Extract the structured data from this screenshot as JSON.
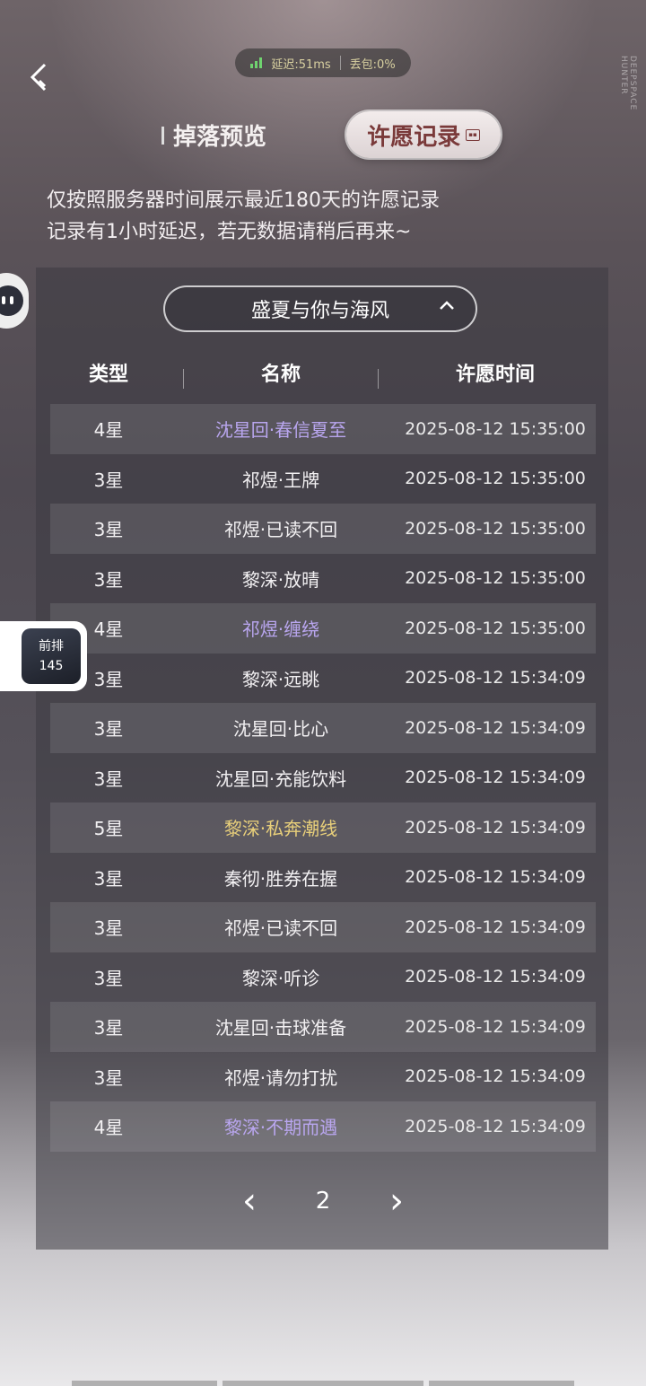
{
  "status": {
    "latency": "延迟:51ms",
    "loss": "丢包:0%"
  },
  "brand": "DEEPSPACE HUNTER",
  "tabs": {
    "drop_preview": "掉落预览",
    "wish_record": "许愿记录"
  },
  "notice": {
    "line1": "仅按照服务器时间展示最近180天的许愿记录",
    "line2": "记录有1小时延迟，若无数据请稍后再来~"
  },
  "selector": {
    "value": "盛夏与你与海风"
  },
  "table": {
    "headers": {
      "type": "类型",
      "name": "名称",
      "time": "许愿时间"
    },
    "rows": [
      {
        "type": "4星",
        "name": "沈星回·春信夏至",
        "time": "2025-08-12 15:35:00"
      },
      {
        "type": "3星",
        "name": "祁煜·王牌",
        "time": "2025-08-12 15:35:00"
      },
      {
        "type": "3星",
        "name": "祁煜·已读不回",
        "time": "2025-08-12 15:35:00"
      },
      {
        "type": "3星",
        "name": "黎深·放晴",
        "time": "2025-08-12 15:35:00"
      },
      {
        "type": "4星",
        "name": "祁煜·缠绕",
        "time": "2025-08-12 15:35:00"
      },
      {
        "type": "3星",
        "name": "黎深·远眺",
        "time": "2025-08-12 15:34:09"
      },
      {
        "type": "3星",
        "name": "沈星回·比心",
        "time": "2025-08-12 15:34:09"
      },
      {
        "type": "3星",
        "name": "沈星回·充能饮料",
        "time": "2025-08-12 15:34:09"
      },
      {
        "type": "5星",
        "name": "黎深·私奔潮线",
        "time": "2025-08-12 15:34:09"
      },
      {
        "type": "3星",
        "name": "秦彻·胜券在握",
        "time": "2025-08-12 15:34:09"
      },
      {
        "type": "3星",
        "name": "祁煜·已读不回",
        "time": "2025-08-12 15:34:09"
      },
      {
        "type": "3星",
        "name": "黎深·听诊",
        "time": "2025-08-12 15:34:09"
      },
      {
        "type": "3星",
        "name": "沈星回·击球准备",
        "time": "2025-08-12 15:34:09"
      },
      {
        "type": "3星",
        "name": "祁煜·请勿打扰",
        "time": "2025-08-12 15:34:09"
      },
      {
        "type": "4星",
        "name": "黎深·不期而遇",
        "time": "2025-08-12 15:34:09"
      }
    ]
  },
  "pager": {
    "prev": "‹",
    "page": "2",
    "next": "›"
  },
  "float_card": {
    "line1": "前排",
    "line2": "145"
  },
  "colors": {
    "rare4": "#b9a6ef",
    "rare5": "#e8cf7a"
  }
}
